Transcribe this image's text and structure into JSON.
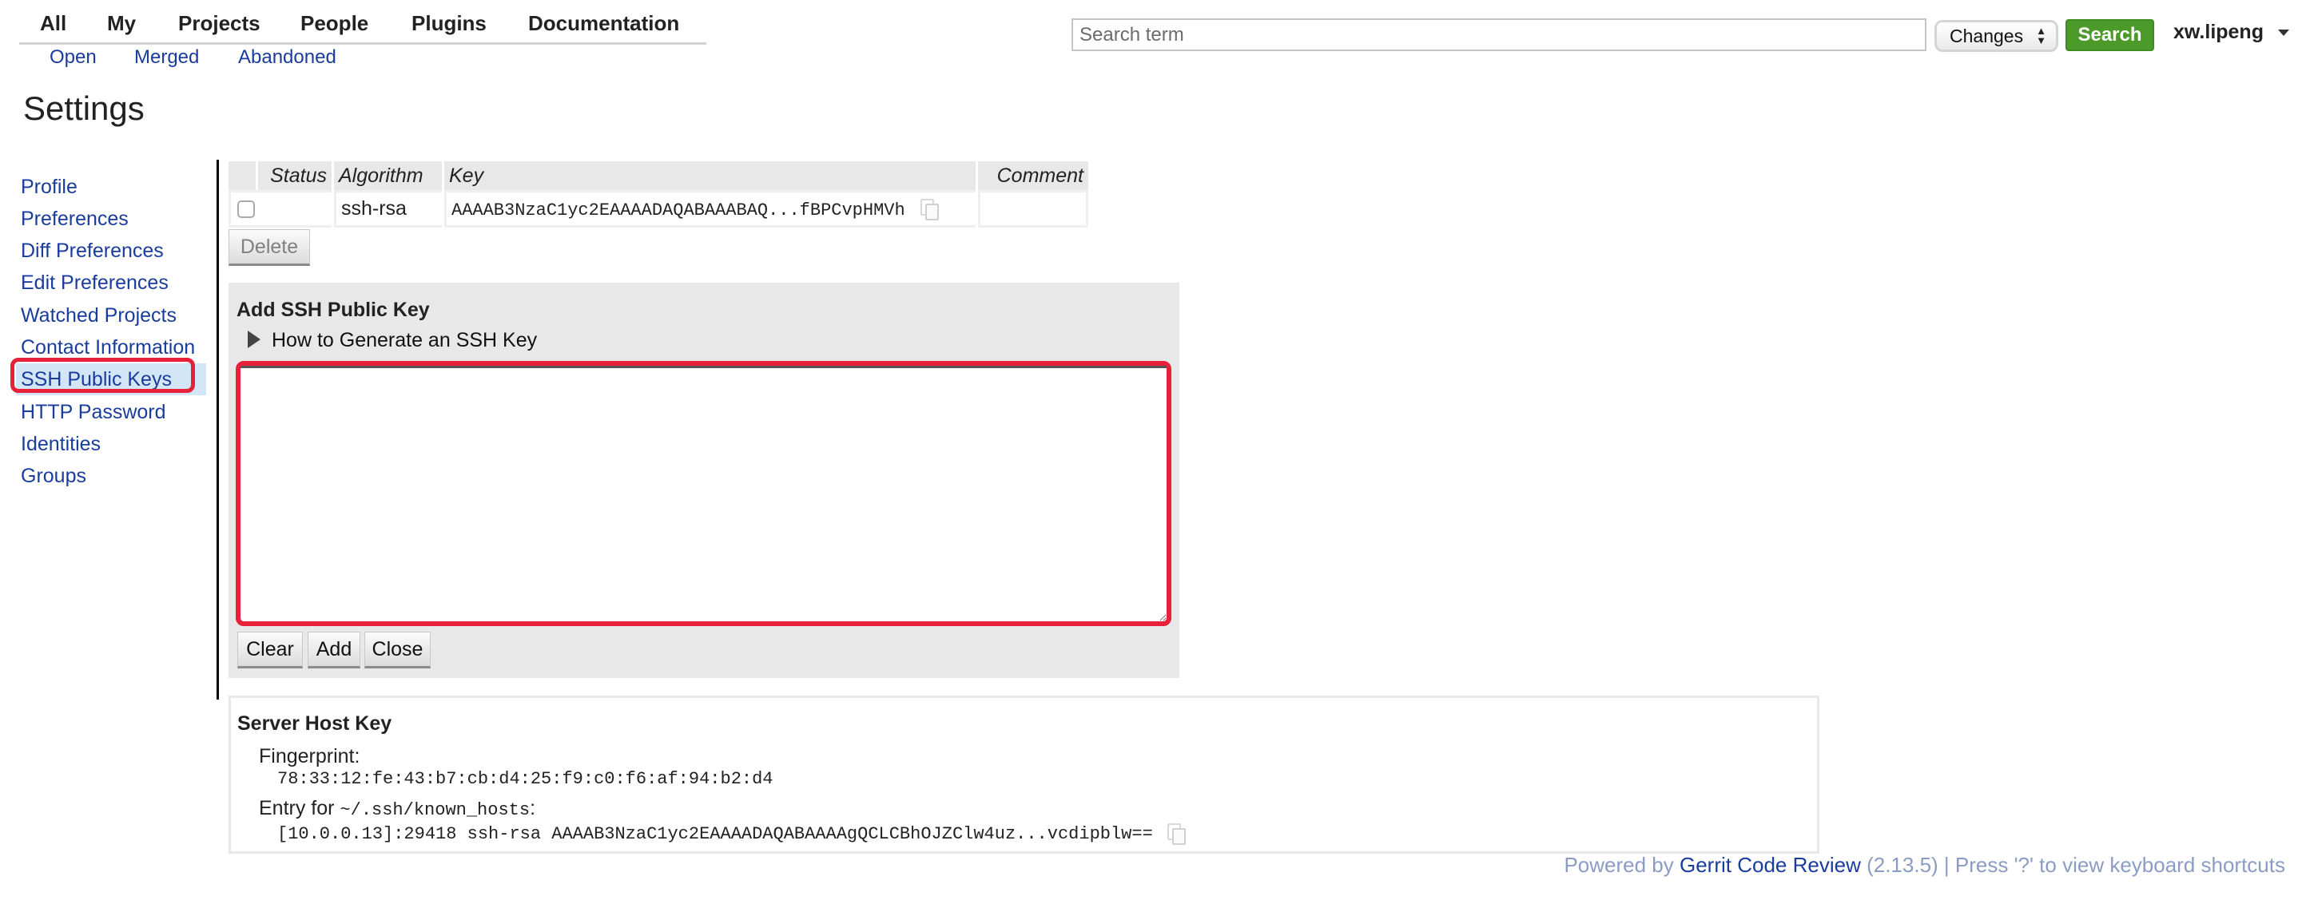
{
  "topnav": {
    "items": [
      "All",
      "My",
      "Projects",
      "People",
      "Plugins",
      "Documentation"
    ],
    "subitems": [
      "Open",
      "Merged",
      "Abandoned"
    ]
  },
  "search": {
    "placeholder": "Search term",
    "value": "",
    "scope": "Changes",
    "button_label": "Search"
  },
  "user": {
    "name": "xw.lipeng"
  },
  "page": {
    "title": "Settings"
  },
  "sidebar": {
    "items": [
      {
        "label": "Profile"
      },
      {
        "label": "Preferences"
      },
      {
        "label": "Diff Preferences"
      },
      {
        "label": "Edit Preferences"
      },
      {
        "label": "Watched Projects"
      },
      {
        "label": "Contact Information"
      },
      {
        "label": "SSH Public Keys",
        "selected": true
      },
      {
        "label": "HTTP Password"
      },
      {
        "label": "Identities"
      },
      {
        "label": "Groups"
      }
    ]
  },
  "keys_table": {
    "headers": [
      "",
      "Status",
      "Algorithm",
      "Key",
      "Comment"
    ],
    "rows": [
      {
        "checked": false,
        "status": "",
        "algorithm": "ssh-rsa",
        "key": "AAAAB3NzaC1yc2EAAAADAQABAAABAQ...fBPCvpHMVh",
        "comment": ""
      }
    ],
    "delete_label": "Delete"
  },
  "add_key": {
    "title": "Add SSH Public Key",
    "howto_label": "How to Generate an SSH Key",
    "textarea_value": "",
    "buttons": {
      "clear": "Clear",
      "add": "Add",
      "close": "Close"
    }
  },
  "server_host_key": {
    "title": "Server Host Key",
    "fingerprint_label": "Fingerprint:",
    "fingerprint": "78:33:12:fe:43:b7:cb:d4:25:f9:c0:f6:af:94:b2:d4",
    "entry_label_prefix": "Entry for ",
    "entry_label_path": "~/.ssh/known_hosts",
    "entry_label_suffix": ":",
    "entry": "[10.0.0.13]:29418 ssh-rsa AAAAB3NzaC1yc2EAAAADAQABAAAAgQCLCBhOJZClw4uz...vcdipblw=="
  },
  "footer": {
    "prefix": "Powered by ",
    "brand": "Gerrit Code Review",
    "suffix": " (2.13.5) | Press '?' to view keyboard shortcuts"
  },
  "colors": {
    "link": "#1a3c9c",
    "search_button": "#4c9a2a",
    "highlight_ring": "#e8203a",
    "selected_bg": "#d2e6f7",
    "panel_bg": "#e8e8e8"
  }
}
